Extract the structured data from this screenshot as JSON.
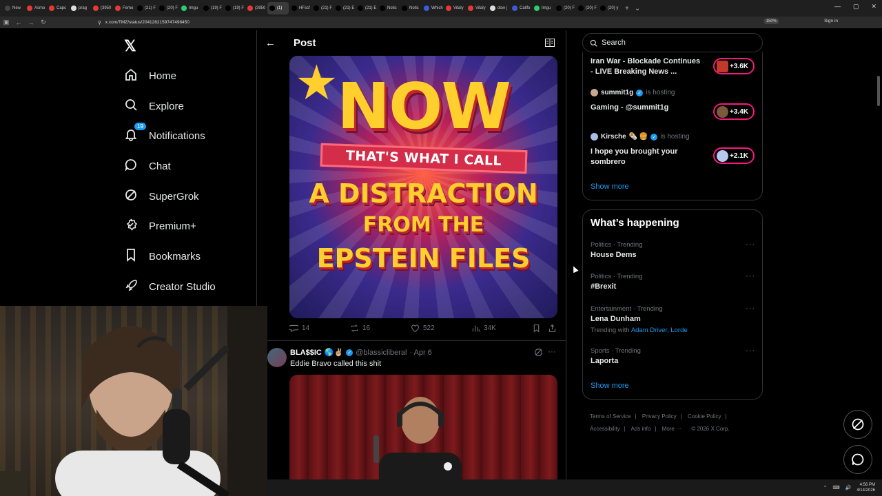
{
  "browser": {
    "tabs": [
      {
        "label": "New",
        "color": "#444"
      },
      {
        "label": "Asmo",
        "color": "#e53935"
      },
      {
        "label": "Capc",
        "color": "#e53935"
      },
      {
        "label": "prag",
        "color": "#ddd"
      },
      {
        "label": "(3950",
        "color": "#e53935"
      },
      {
        "label": "Femo",
        "color": "#e53935"
      },
      {
        "label": "(21) F",
        "color": "#000"
      },
      {
        "label": "(20) F",
        "color": "#000"
      },
      {
        "label": "Imgu",
        "color": "#2ecc71"
      },
      {
        "label": "(19) F",
        "color": "#000"
      },
      {
        "label": "(19) F",
        "color": "#000"
      },
      {
        "label": "(3950",
        "color": "#e53935"
      },
      {
        "label": "(1)",
        "color": "#000"
      },
      {
        "label": "HFscf",
        "color": "#000"
      },
      {
        "label": "(21) F",
        "color": "#000"
      },
      {
        "label": "(21) E",
        "color": "#000"
      },
      {
        "label": "(21) E",
        "color": "#000"
      },
      {
        "label": "Notic",
        "color": "#000"
      },
      {
        "label": "Notic",
        "color": "#000"
      },
      {
        "label": "Which",
        "color": "#3b5bdb"
      },
      {
        "label": "Vitaly",
        "color": "#e53935"
      },
      {
        "label": "Vitaly",
        "color": "#e53935"
      },
      {
        "label": "dow j",
        "color": "#ddd"
      },
      {
        "label": "Califo",
        "color": "#3b5bdb"
      },
      {
        "label": "Imgu",
        "color": "#2ecc71"
      },
      {
        "label": "(20) F",
        "color": "#000"
      },
      {
        "label": "(20) F",
        "color": "#000"
      },
      {
        "label": "(20) y",
        "color": "#000"
      }
    ],
    "url": "x.com/TMZ/status/2041282159747498450",
    "zoom": "150%",
    "signin": "Sign in"
  },
  "nav": {
    "logo": "𝕏",
    "items": [
      {
        "label": "Home",
        "icon": "home-icon"
      },
      {
        "label": "Explore",
        "icon": "search-icon"
      },
      {
        "label": "Notifications",
        "icon": "bell-icon",
        "badge": "19"
      },
      {
        "label": "Chat",
        "icon": "chat-icon"
      },
      {
        "label": "SuperGrok",
        "icon": "grok-icon"
      },
      {
        "label": "Premium+",
        "icon": "premium-icon"
      },
      {
        "label": "Bookmarks",
        "icon": "bookmark-icon"
      },
      {
        "label": "Creator Studio",
        "icon": "rocket-icon"
      }
    ]
  },
  "post": {
    "header_title": "Post",
    "poster": {
      "line1": "NOW",
      "line2": "THAT'S WHAT I CALL",
      "line3": "A DISTRACTION",
      "line4": "FROM THE",
      "line5": "EPSTEIN FILES"
    },
    "stats": {
      "replies": "14",
      "reposts": "16",
      "likes": "522",
      "views": "34K"
    }
  },
  "reply": {
    "name": "BLA$$IC",
    "handle": "@blassicliberal",
    "date": "· Apr 6",
    "text": "Eddie Bravo called this shit"
  },
  "right": {
    "search_placeholder": "Search",
    "live": [
      {
        "title_line1": "Iran War - Blockade Continues",
        "title_line2": "- LIVE Breaking News ...",
        "count": "+3.6K",
        "pill_color": "#c0392b"
      },
      {
        "host": "summit1g",
        "hosting": "is hosting",
        "title_line1": "Gaming - @summit1g",
        "title_line2": "",
        "count": "+3.4K",
        "pill_color": "#7a5a3a"
      },
      {
        "host": "Kirsche",
        "hosting": "is hosting",
        "title_line1": "I hope you brought your",
        "title_line2": "sombrero",
        "count": "+2.1K",
        "pill_color": "#b8c9f0"
      }
    ],
    "live_show_more": "Show more",
    "happening_title": "What’s happening",
    "trends": [
      {
        "meta": "Politics · Trending",
        "name": "House Dems"
      },
      {
        "meta": "Politics · Trending",
        "name": "#Brexit"
      },
      {
        "meta": "Entertainment · Trending",
        "name": "Lena Dunham",
        "with_label": "Trending with",
        "with_links": "Adam Driver, Lorde"
      },
      {
        "meta": "Sports · Trending",
        "name": "Laporta"
      }
    ],
    "happening_show_more": "Show more",
    "footer": {
      "terms": "Terms of Service",
      "privacy": "Privacy Policy",
      "cookie": "Cookie Policy",
      "accessibility": "Accessibility",
      "ads": "Ads info",
      "more": "More ···",
      "copyright": "© 2026 X Corp."
    }
  },
  "taskbar": {
    "time": "4:56 PM",
    "date": "4/14/2026"
  },
  "colors": {
    "accent": "#1d9bf0",
    "live_pink": "#f91880"
  }
}
